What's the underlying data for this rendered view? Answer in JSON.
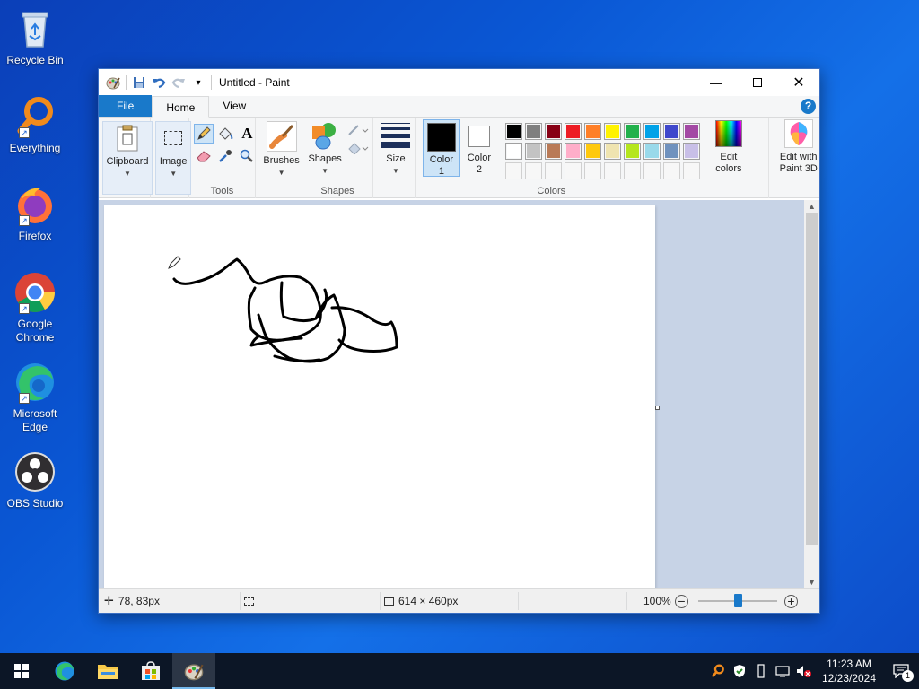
{
  "desktop": {
    "icons": [
      {
        "label": "Recycle Bin"
      },
      {
        "label": "Everything"
      },
      {
        "label": "Firefox"
      },
      {
        "label": "Google Chrome"
      },
      {
        "label": "Microsoft Edge"
      },
      {
        "label": "OBS Studio"
      }
    ]
  },
  "window": {
    "title": "Untitled - Paint",
    "tabs": [
      {
        "label": "File"
      },
      {
        "label": "Home"
      },
      {
        "label": "View"
      }
    ],
    "ribbon": {
      "clipboard": "Clipboard",
      "image": "Image",
      "tools_group": "Tools",
      "brushes": "Brushes",
      "shapes": "Shapes",
      "shapes_group": "Shapes",
      "size": "Size",
      "color1": "Color\n1",
      "color1_line1": "Color",
      "color1_line2": "1",
      "color2_line1": "Color",
      "color2_line2": "2",
      "colors_group": "Colors",
      "edit_colors_line1": "Edit",
      "edit_colors_line2": "colors",
      "paint3d_line1": "Edit with",
      "paint3d_line2": "Paint 3D"
    },
    "colors": {
      "color1": "#000000",
      "color2": "#ffffff",
      "palette_row1": [
        "#000000",
        "#7f7f7f",
        "#880015",
        "#ed1c24",
        "#ff7f27",
        "#fff200",
        "#22b14c",
        "#00a2e8",
        "#3f48cc",
        "#a349a4"
      ],
      "palette_row2": [
        "#ffffff",
        "#c3c3c3",
        "#b97a57",
        "#ffaec9",
        "#ffc90e",
        "#efe4b0",
        "#b5e61d",
        "#99d9ea",
        "#7092be",
        "#c8bfe7"
      ],
      "accent": "#1979ca"
    },
    "status": {
      "cursor_pos": "78, 83px",
      "canvas_size": "614 × 460px",
      "zoom": "100%",
      "zoom_fraction": 0.5
    }
  },
  "taskbar": {
    "time": "11:23 AM",
    "date": "12/23/2024",
    "notifications": "1"
  }
}
